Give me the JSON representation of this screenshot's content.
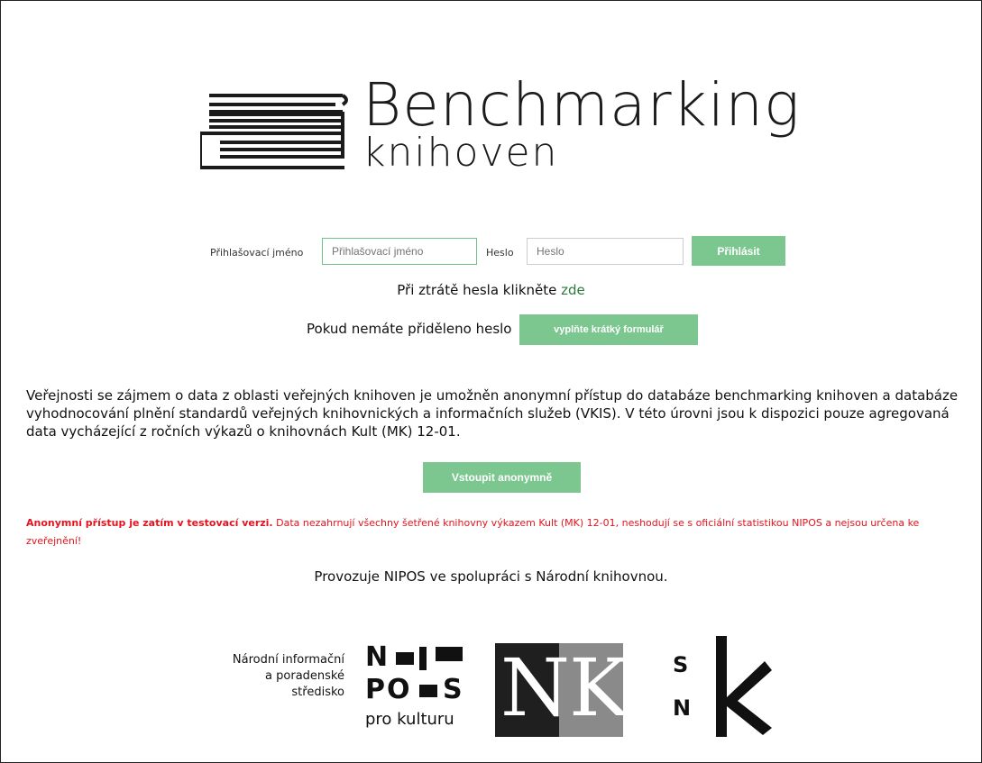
{
  "logo": {
    "title": "Benchmarking",
    "subtitle": "knihoven"
  },
  "login": {
    "username_label": "Přihlašovací jméno",
    "username_placeholder": "Přihlašovací jméno",
    "password_label": "Heslo",
    "password_placeholder": "Heslo",
    "submit_label": "Přihlásit"
  },
  "forgot": {
    "prefix": "Při ztrátě hesla klikněte ",
    "link": "zde"
  },
  "request": {
    "prefix": "Pokud nemáte přiděleno heslo",
    "button": "vyplňte krátký formulář"
  },
  "intro_paragraph": "Veřejnosti se zájmem o data z oblasti veřejných knihoven je umožněn anonymní přístup do databáze benchmarking knihoven a databáze vyhodnocování plnění standardů veřejných knihovnických a informačních služeb (VKIS). V této úrovni jsou k dispozici pouze agregovaná data vycházející z ročních výkazů o knihovnách Kult (MK) 12-01.",
  "anonymous_button": "Vstoupit anonymně",
  "warning": {
    "bold": "Anonymní přístup je zatím v testovací verzi.",
    "text": " Data nezahrnují všechny šetřené knihovny výkazem Kult (MK) 12-01, neshodují se s oficiální statistikou NIPOS a nejsou určena ke zveřejnění!"
  },
  "footer_text": "Provozuje NIPOS ve spolupráci s Národní knihovnou.",
  "partners": {
    "nipos_lines": [
      "Národní informační",
      "a poradenské",
      "středisko"
    ],
    "nipos_word_top": "N",
    "nipos_word_mid": "PO",
    "nipos_word_s": "S",
    "nipos_sub": "pro kulturu",
    "nk_left": "N",
    "nk_right": "K",
    "snk_s": "S",
    "snk_n": "N"
  },
  "colors": {
    "accent_green": "#7cc78f",
    "link_green": "#2a7a3a",
    "warning_red": "#e3141d"
  }
}
